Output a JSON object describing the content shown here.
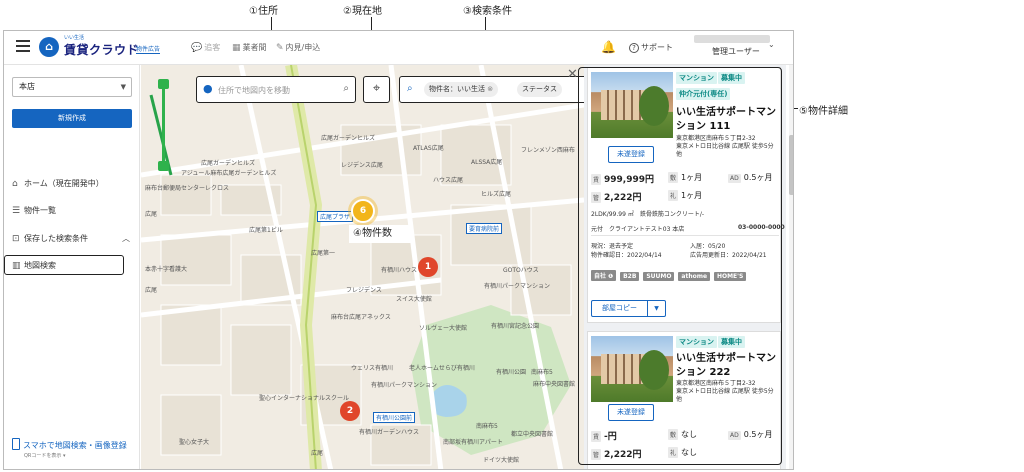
{
  "annotations": {
    "address": "①住所",
    "current_location": "②現在地",
    "search_conditions": "③検索条件",
    "property_count": "④物件数",
    "property_details": "⑤物件詳細"
  },
  "header": {
    "logo_small": "いい生活",
    "logo_main": "賃貸クラウド",
    "logo_badge": "物件広告",
    "nav": [
      {
        "icon": "chat-icon",
        "label": "追客"
      },
      {
        "icon": "building-icon",
        "label": "業者間"
      },
      {
        "icon": "pen-icon",
        "label": "内見/申込"
      }
    ],
    "support_label": "サポート",
    "user_name": "管理ユーザー"
  },
  "sidebar": {
    "store_value": "本店",
    "new_button": "新規作成",
    "items": [
      {
        "icon": "home-icon",
        "label": "ホーム（現在開発中）"
      },
      {
        "icon": "list-icon",
        "label": "物件一覧"
      },
      {
        "icon": "saved-search-icon",
        "label": "保存した検索条件"
      },
      {
        "icon": "map-icon",
        "label": "地図検索"
      }
    ],
    "app_promo": "スマホで地図検索・画像登録",
    "app_promo_sub": "QRコードを表示 ▾"
  },
  "map": {
    "search_placeholder": "住所で地図内を移動",
    "filter_chips": [
      "物件名：いい生活",
      "ステータス"
    ],
    "clusters": {
      "c6": "6",
      "c1": "1",
      "c2": "2"
    },
    "labels": {
      "l1": "広尾ガーデンヒルズ",
      "l2": "アジュール麻布広尾ガーデンヒルズ",
      "l3": "麻布台郵便局センターレクロス",
      "l4": "広尾",
      "l5": "広尾第1ビル",
      "l6": "広尾第一",
      "l7": "本赤十字看護大",
      "l8": "広尾",
      "l9": "レジデンス広尾",
      "l10": "ATLAS広尾",
      "l11": "ハウス広尾",
      "l12": "広尾ガーデンヒルズ",
      "l13": "有栖川宮記念公園",
      "l14": "南麻布5",
      "l15": "有栖川ハウス",
      "l16": "要育病院前",
      "l17": "GOTOハウス",
      "l18": "有栖川パークマンション",
      "l19": "スイス大使館",
      "l20": "フレジデンス",
      "l21": "麻布台広尾アネックス",
      "l22": "ウェリス有栖川",
      "l23": "老人ホームせらび有栖川",
      "l24": "有栖川パークマンション",
      "l25": "聖心インターナショナルスクール",
      "l26": "聖心女子大",
      "l27": "広尾",
      "l28": "南部坂有栖川アパート",
      "l29": "ソルヴェー大使館",
      "l30": "有栖川公園前",
      "l31": "有栖川ガーデンハウス",
      "l32": "南麻布5",
      "l33": "広尾プラザ",
      "l34": "有栖川公園",
      "l35": "麻布中央図書館",
      "l36": "ドイツ大使館",
      "l37": "都立中央図書館",
      "l38": "ALSSA広尾",
      "l39": "ヒルズ広尾",
      "l40": "フレンメゾン西麻布"
    }
  },
  "properties": [
    {
      "tags": [
        "マンション",
        "募集中",
        "仲介元付(専任)"
      ],
      "name": "いい生活サポートマンション 111",
      "address": "東京都港区南麻布５丁目2-32",
      "access": "東京メトロ日比谷線 広尾駅 徒歩5分 他",
      "register_button": "未遂登録",
      "rent_key": "賃",
      "rent": "999,999円",
      "deposit_key": "敷",
      "deposit": "1ヶ月",
      "ad_key": "AD",
      "ad": "0.5ヶ月",
      "mgmt_key": "管",
      "mgmt": "2,222円",
      "key_money_key": "礼",
      "key_money": "1ヶ月",
      "layout_line": "2LDK/99.99 ㎡　鉄骨鉄筋コンクリート/-",
      "agent_line": "元付　クライアントテスト03 本店",
      "agent_phone": "03-0000-0000",
      "status_line": "現況：退去予定",
      "move_in": "入居：05/20",
      "confirmed": "物件確認日：2022/04/14",
      "ad_updated": "広告用更新日：2022/04/21",
      "portals": [
        "自社 ❶",
        "B2B",
        "SUUMO",
        "athome",
        "HOME'S"
      ],
      "copy_button": "部屋コピー"
    },
    {
      "tags": [
        "マンション",
        "募集中"
      ],
      "name": "いい生活サポートマンション 222",
      "address": "東京都港区南麻布５丁目2-32",
      "access": "東京メトロ日比谷線 広尾駅 徒歩5分 他",
      "register_button": "未遂登録",
      "rent_key": "賃",
      "rent": "-円",
      "deposit_key": "敷",
      "deposit": "なし",
      "ad_key": "AD",
      "ad": "0.5ヶ月",
      "mgmt_key": "管",
      "mgmt": "2,222円",
      "key_money_key": "礼",
      "key_money": "なし"
    }
  ]
}
